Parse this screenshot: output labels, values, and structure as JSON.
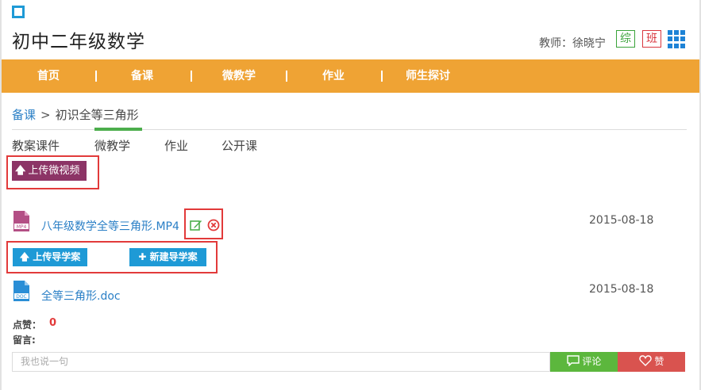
{
  "header": {
    "course_title": "初中二年级数学",
    "teacher_label": "教师：徐晓宁",
    "badge_zong": "综",
    "badge_ban": "班"
  },
  "nav": {
    "items": [
      "首页",
      "备课",
      "微教学",
      "作业",
      "师生探讨"
    ]
  },
  "breadcrumb": {
    "root": "备课",
    "separator": ">",
    "current": "初识全等三角形"
  },
  "tabs": [
    "教案课件",
    "微教学",
    "作业",
    "公开课"
  ],
  "active_tab": "微教学",
  "upload_video_label": "上传微视频",
  "files": [
    {
      "icon_label": "MP4",
      "name": "八年级数学全等三角形.MP4",
      "date": "2015-08-18"
    },
    {
      "icon_label": "DOC",
      "name": "全等三角形.doc",
      "date": "2015-08-18"
    }
  ],
  "actions": {
    "upload_guide": "上传导学案",
    "new_guide": "新建导学案"
  },
  "feedback": {
    "like_label": "点赞：",
    "like_count": "0",
    "comment_label": "留言:",
    "comment_placeholder": "我也说一句",
    "comment_button": "评论",
    "zan_button": "赞"
  },
  "colors": {
    "nav_bg": "#efa334",
    "link": "#2a7fc6",
    "upload_video_bg": "#8c3466",
    "blue_button": "#1e9ad6",
    "comment_green": "#5cb73d",
    "zan_red": "#d9534f",
    "highlight_red": "#e23a3a"
  },
  "icons": [
    "logo-square-icon",
    "grid-apps-icon",
    "mp4-file-icon",
    "edit-icon",
    "delete-icon",
    "doc-file-icon",
    "upload-arrow-icon",
    "plus-icon",
    "chat-icon",
    "heart-icon"
  ]
}
